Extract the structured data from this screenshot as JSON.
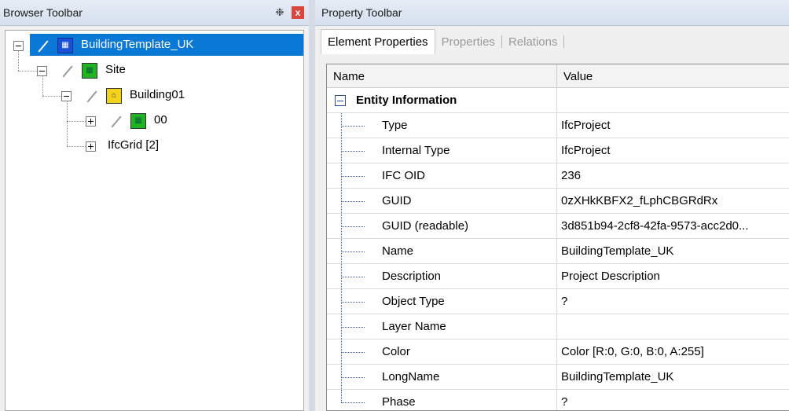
{
  "browser_toolbar": {
    "title": "Browser Toolbar",
    "pin_glyph": "❉",
    "close_glyph": "x",
    "tree": [
      {
        "label": "BuildingTemplate_UK",
        "icon": "project-icon",
        "icon_color": "#1a4fd8",
        "selected": true
      },
      {
        "label": "Site",
        "icon": "site-icon",
        "icon_color": "#22b322"
      },
      {
        "label": "Building01",
        "icon": "building-icon",
        "icon_color": "#f2d21b"
      },
      {
        "label": "00",
        "icon": "storey-icon",
        "icon_color": "#22b322"
      },
      {
        "label": "IfcGrid [2]"
      }
    ]
  },
  "property_toolbar": {
    "title": "Property Toolbar",
    "tabs": [
      "Element Properties",
      "Properties",
      "Relations"
    ],
    "active_tab": "Element Properties",
    "columns": [
      "Name",
      "Value"
    ],
    "group": "Entity Information",
    "rows": [
      {
        "name": "Type",
        "value": "IfcProject"
      },
      {
        "name": "Internal Type",
        "value": "IfcProject"
      },
      {
        "name": "IFC OID",
        "value": "236"
      },
      {
        "name": "GUID",
        "value": "0zXHkKBFX2_fLphCBGRdRx"
      },
      {
        "name": "GUID (readable)",
        "value": "3d851b94-2cf8-42fa-9573-acc2d0..."
      },
      {
        "name": "Name",
        "value": "BuildingTemplate_UK"
      },
      {
        "name": "Description",
        "value": "Project Description"
      },
      {
        "name": "Object Type",
        "value": "?"
      },
      {
        "name": "Layer Name",
        "value": ""
      },
      {
        "name": "Color",
        "value": "Color [R:0, G:0, B:0, A:255]"
      },
      {
        "name": "LongName",
        "value": "BuildingTemplate_UK"
      },
      {
        "name": "Phase",
        "value": "?"
      }
    ]
  }
}
